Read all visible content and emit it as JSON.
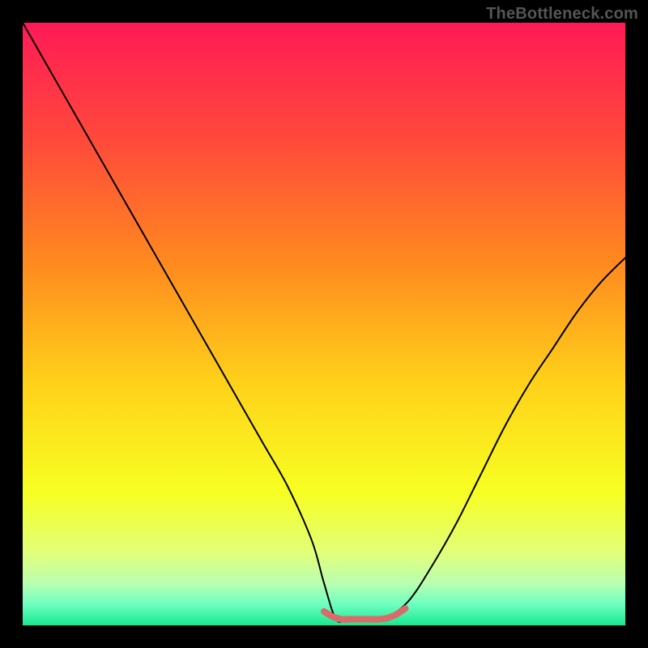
{
  "watermark": "TheBottleneck.com",
  "chart_data": {
    "type": "line",
    "title": "",
    "xlabel": "",
    "ylabel": "",
    "xlim": [
      0,
      100
    ],
    "ylim": [
      0,
      100
    ],
    "grid": false,
    "legend": false,
    "gradient_stops": [
      {
        "pos": 0.0,
        "color": "#ff1a57"
      },
      {
        "pos": 0.2,
        "color": "#ff4b3a"
      },
      {
        "pos": 0.4,
        "color": "#ff8a1f"
      },
      {
        "pos": 0.6,
        "color": "#ffd21a"
      },
      {
        "pos": 0.78,
        "color": "#f7ff22"
      },
      {
        "pos": 0.88,
        "color": "#e1ff7a"
      },
      {
        "pos": 0.93,
        "color": "#b9ffb0"
      },
      {
        "pos": 0.965,
        "color": "#6fffc0"
      },
      {
        "pos": 1.0,
        "color": "#18e88f"
      }
    ],
    "series": [
      {
        "name": "bottleneck-curve",
        "stroke": "#000000",
        "stroke_width": 2,
        "x": [
          0,
          4,
          8,
          12,
          16,
          20,
          24,
          28,
          32,
          36,
          40,
          44,
          48,
          50,
          52,
          54,
          58,
          60,
          64,
          68,
          72,
          76,
          80,
          84,
          88,
          92,
          96,
          100
        ],
        "y": [
          100,
          93,
          86,
          79,
          72,
          65,
          58,
          51,
          44,
          37,
          30,
          23,
          14,
          7,
          1,
          1,
          1,
          1,
          4,
          10,
          17,
          25,
          33,
          40,
          46,
          52,
          57,
          61
        ]
      },
      {
        "name": "low-band-highlight",
        "stroke": "#db6a6a",
        "stroke_width": 8,
        "x": [
          50,
          51.5,
          53,
          54.5,
          56,
          57.5,
          59,
          60.5,
          62,
          63.5
        ],
        "y": [
          2.3,
          1.4,
          1.0,
          1.0,
          1.0,
          1.0,
          1.0,
          1.2,
          1.8,
          2.8
        ]
      }
    ]
  }
}
